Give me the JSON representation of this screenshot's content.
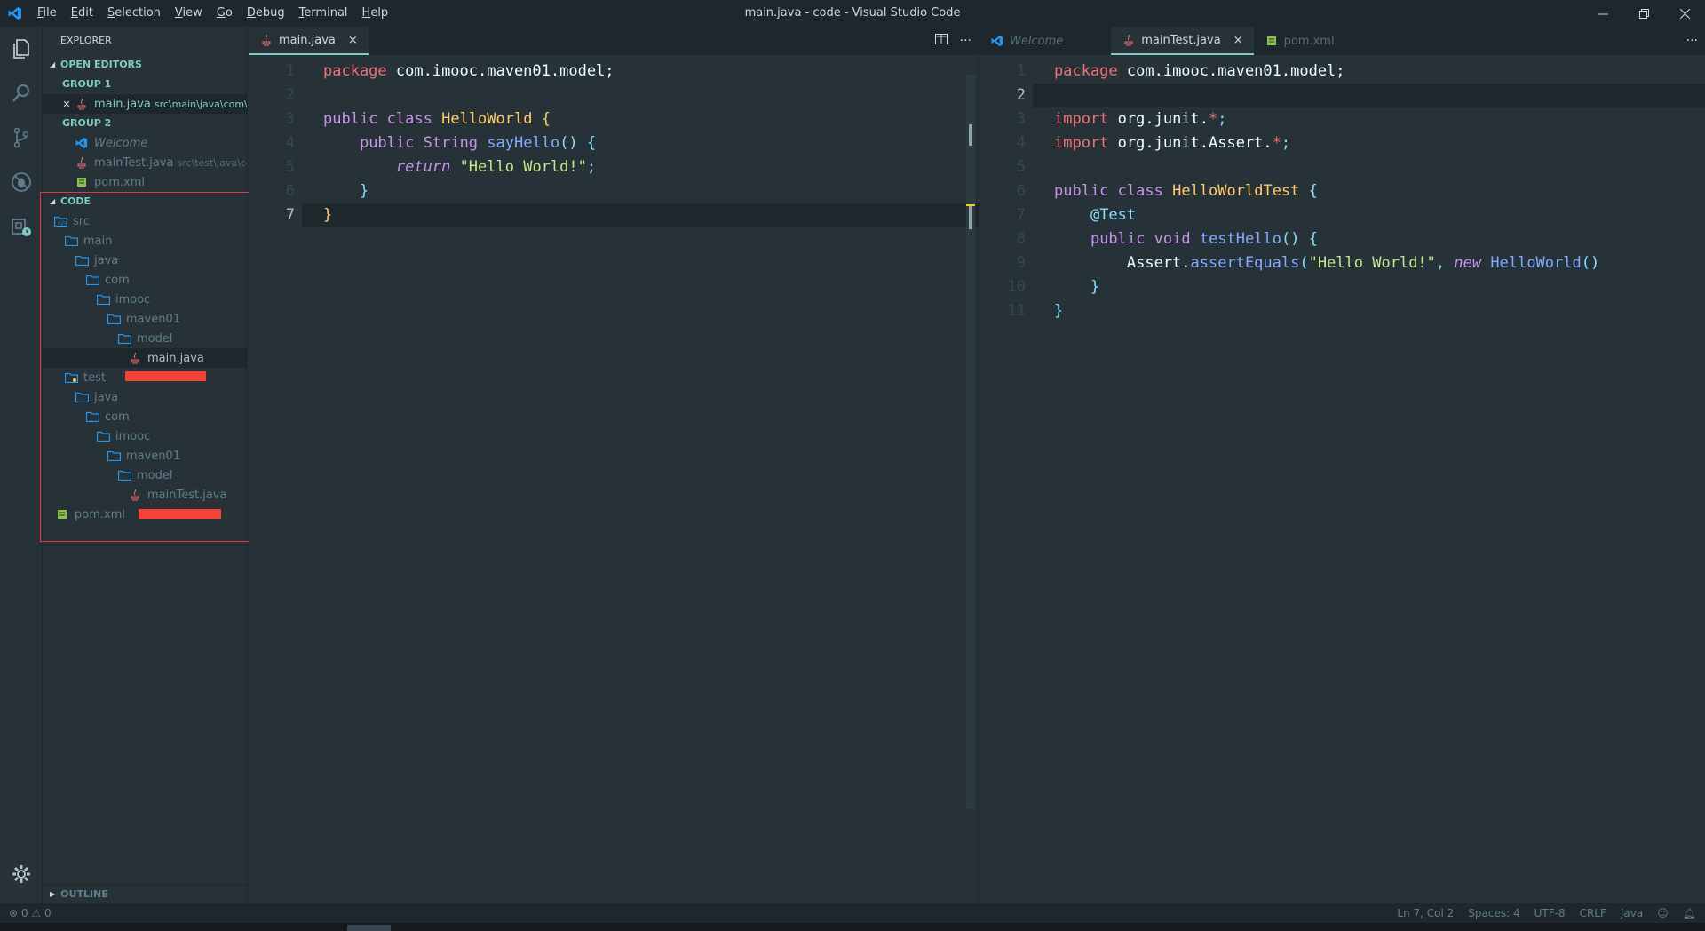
{
  "window": {
    "title": "main.java - code - Visual Studio Code",
    "menu": [
      "File",
      "Edit",
      "Selection",
      "View",
      "Go",
      "Debug",
      "Terminal",
      "Help"
    ]
  },
  "sidebar": {
    "title": "EXPLORER",
    "open_editors": {
      "label": "OPEN EDITORS",
      "group1": {
        "label": "GROUP 1",
        "items": [
          {
            "name": "main.java",
            "desc": "src\\main\\java\\com\\i..."
          }
        ]
      },
      "group2": {
        "label": "GROUP 2",
        "items": [
          {
            "name": "Welcome",
            "desc": ""
          },
          {
            "name": "mainTest.java",
            "desc": "src\\test\\java\\co..."
          },
          {
            "name": "pom.xml",
            "desc": ""
          }
        ]
      }
    },
    "folder": {
      "label": "CODE",
      "tree": [
        {
          "name": "src",
          "depth": 0
        },
        {
          "name": "main",
          "depth": 1
        },
        {
          "name": "java",
          "depth": 2
        },
        {
          "name": "com",
          "depth": 3
        },
        {
          "name": "imooc",
          "depth": 4
        },
        {
          "name": "maven01",
          "depth": 5
        },
        {
          "name": "model",
          "depth": 6
        },
        {
          "name": "main.java",
          "depth": 7
        },
        {
          "name": "test",
          "depth": 1
        },
        {
          "name": "java",
          "depth": 2
        },
        {
          "name": "com",
          "depth": 3
        },
        {
          "name": "imooc",
          "depth": 4
        },
        {
          "name": "maven01",
          "depth": 5
        },
        {
          "name": "model",
          "depth": 6
        },
        {
          "name": "mainTest.java",
          "depth": 7
        },
        {
          "name": "pom.xml",
          "depth": 0
        }
      ]
    },
    "outline": "OUTLINE"
  },
  "editor1": {
    "tabs": [
      {
        "name": "main.java",
        "close": "×"
      }
    ],
    "lines": [
      {
        "n": "1",
        "html": [
          [
            "pk",
            "package"
          ],
          [
            "wh",
            " com.imooc.maven01.model;"
          ]
        ]
      },
      {
        "n": "2",
        "html": []
      },
      {
        "n": "3",
        "html": [
          [
            "kw",
            "public"
          ],
          [
            "wh",
            " "
          ],
          [
            "kw",
            "class"
          ],
          [
            "wh",
            " "
          ],
          [
            "ty",
            "HelloWorld"
          ],
          [
            "wh",
            " "
          ],
          [
            "ty",
            "{"
          ]
        ]
      },
      {
        "n": "4",
        "html": [
          [
            "wh",
            "    "
          ],
          [
            "kw",
            "public"
          ],
          [
            "wh",
            " "
          ],
          [
            "kw",
            "String"
          ],
          [
            "wh",
            " "
          ],
          [
            "fn",
            "sayHello"
          ],
          [
            "pn",
            "()"
          ],
          [
            "wh",
            " "
          ],
          [
            "pn",
            "{"
          ]
        ]
      },
      {
        "n": "5",
        "html": [
          [
            "wh",
            "        "
          ],
          [
            "it",
            "return"
          ],
          [
            "wh",
            " "
          ],
          [
            "st",
            "\"Hello World!\""
          ],
          [
            "pn",
            ";"
          ]
        ]
      },
      {
        "n": "6",
        "html": [
          [
            "wh",
            "    "
          ],
          [
            "pn",
            "}"
          ]
        ]
      },
      {
        "n": "7",
        "html": [
          [
            "ty",
            "}"
          ]
        ]
      }
    ]
  },
  "editor2": {
    "tabs": [
      {
        "name": "Welcome"
      },
      {
        "name": "mainTest.java",
        "close": "×"
      },
      {
        "name": "pom.xml"
      }
    ],
    "lines": [
      {
        "n": "1",
        "html": [
          [
            "pk",
            "package"
          ],
          [
            "wh",
            " com.imooc.maven01.model;"
          ]
        ]
      },
      {
        "n": "2",
        "html": []
      },
      {
        "n": "3",
        "html": [
          [
            "pk",
            "import"
          ],
          [
            "wh",
            " org.junit."
          ],
          [
            "pk",
            "*"
          ],
          [
            "pn",
            ";"
          ]
        ]
      },
      {
        "n": "4",
        "html": [
          [
            "pk",
            "import"
          ],
          [
            "wh",
            " org.junit.Assert."
          ],
          [
            "pk",
            "*"
          ],
          [
            "pn",
            ";"
          ]
        ]
      },
      {
        "n": "5",
        "html": []
      },
      {
        "n": "6",
        "html": [
          [
            "kw",
            "public"
          ],
          [
            "wh",
            " "
          ],
          [
            "kw",
            "class"
          ],
          [
            "wh",
            " "
          ],
          [
            "ty",
            "HelloWorldTest"
          ],
          [
            "wh",
            " "
          ],
          [
            "pn",
            "{"
          ]
        ]
      },
      {
        "n": "7",
        "html": [
          [
            "wh",
            "    "
          ],
          [
            "ann",
            "@Test"
          ]
        ]
      },
      {
        "n": "8",
        "html": [
          [
            "wh",
            "    "
          ],
          [
            "kw",
            "public"
          ],
          [
            "wh",
            " "
          ],
          [
            "kw",
            "void"
          ],
          [
            "wh",
            " "
          ],
          [
            "fn",
            "testHello"
          ],
          [
            "pn",
            "()"
          ],
          [
            "wh",
            " "
          ],
          [
            "pn",
            "{"
          ]
        ]
      },
      {
        "n": "9",
        "html": [
          [
            "wh",
            "        Assert."
          ],
          [
            "fn",
            "assertEquals"
          ],
          [
            "pn",
            "("
          ],
          [
            "st",
            "\"Hello World!\""
          ],
          [
            "pn",
            ","
          ],
          [
            "wh",
            " "
          ],
          [
            "it",
            "new"
          ],
          [
            "wh",
            " "
          ],
          [
            "fn",
            "HelloWorld"
          ],
          [
            "pn",
            "()"
          ]
        ]
      },
      {
        "n": "10",
        "html": [
          [
            "wh",
            "    "
          ],
          [
            "pn",
            "}"
          ]
        ]
      },
      {
        "n": "11",
        "html": [
          [
            "pn",
            "}"
          ]
        ]
      }
    ]
  },
  "status": {
    "errors": "0",
    "warnings": "0",
    "position": "Ln 7, Col 2",
    "spaces": "Spaces: 4",
    "encoding": "UTF-8",
    "eol": "CRLF",
    "language": "Java"
  },
  "colors": {
    "background": "#263238",
    "accent": "#80cbc4",
    "highlight_border": "#e53935",
    "folder_icon": "#2196f3"
  }
}
